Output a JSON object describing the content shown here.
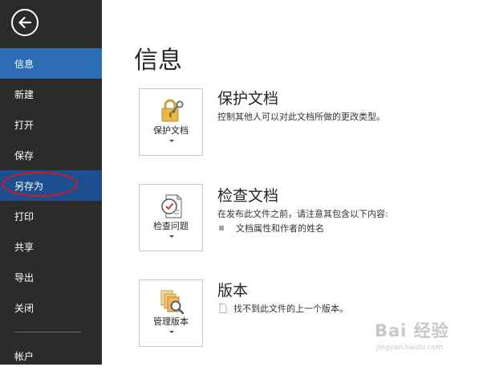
{
  "sidebar": {
    "items": [
      {
        "label": "信息",
        "state": "selected"
      },
      {
        "label": "新建",
        "state": ""
      },
      {
        "label": "打开",
        "state": ""
      },
      {
        "label": "保存",
        "state": ""
      },
      {
        "label": "另存为",
        "state": "hover"
      },
      {
        "label": "打印",
        "state": ""
      },
      {
        "label": "共享",
        "state": ""
      },
      {
        "label": "导出",
        "state": ""
      },
      {
        "label": "关闭",
        "state": ""
      },
      {
        "label": "帐户",
        "state": ""
      }
    ],
    "back_icon": "back-arrow-icon"
  },
  "main": {
    "title": "信息",
    "sections": [
      {
        "button_label": "保护文档",
        "icon": "lock-key-icon",
        "title": "保护文档",
        "description": "控制其他人可以对此文档所做的更改类型。"
      },
      {
        "button_label": "检查问题",
        "icon": "checklist-icon",
        "title": "检查文档",
        "description": "在发布此文件之前，请注意其包含以下内容:",
        "bullets": [
          "文档属性和作者的姓名"
        ]
      },
      {
        "button_label": "管理版本",
        "icon": "documents-search-icon",
        "title": "版本",
        "bullets": [
          "找不到此文件的上一个版本。"
        ]
      }
    ]
  },
  "watermark": {
    "brand": "Bai 经验",
    "url": "jingyan.baidu.com"
  },
  "colors": {
    "sidebar_bg": "#2b2b2b",
    "selected_bg": "#2d6db5",
    "hover_bg": "#1c4f8f",
    "annotation": "#e0141e"
  }
}
